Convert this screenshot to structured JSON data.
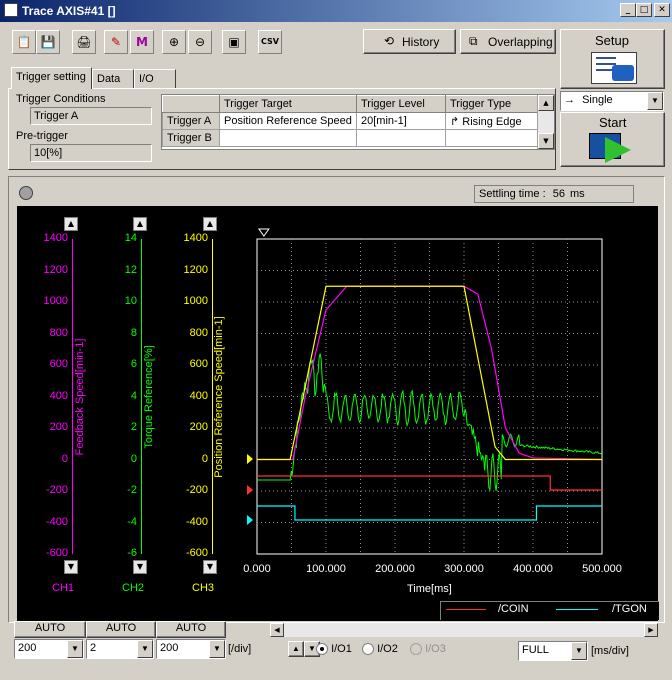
{
  "window": {
    "title": "Trace  AXIS#41 []"
  },
  "toolbar": {
    "icons": [
      "open-icon",
      "save-icon",
      "print-icon",
      "zoom-pen-icon",
      "cursor-m-icon",
      "zoom-in-icon",
      "zoom-out-icon",
      "capture-icon",
      "csv-icon"
    ],
    "csv_label": "CSV",
    "history_label": "History",
    "overlapping_label": "Overlapping"
  },
  "setup": {
    "label": "Setup"
  },
  "run_mode": {
    "selected": "Single"
  },
  "start": {
    "label": "Start"
  },
  "tabs": [
    {
      "label": "Trigger setting",
      "active": true
    },
    {
      "label": "Data",
      "active": false
    },
    {
      "label": "I/O",
      "active": false
    }
  ],
  "trigger": {
    "conditions_label": "Trigger Conditions",
    "conditions_value": "Trigger A",
    "pretrigger_label": "Pre-trigger",
    "pretrigger_value": "10[%]",
    "headers": [
      "Trigger Target",
      "Trigger Level",
      "Trigger Type"
    ],
    "rows": [
      {
        "name": "Trigger A",
        "target": "Position Reference Speed",
        "level": "20[min-1]",
        "type": "Rising Edge"
      },
      {
        "name": "Trigger B",
        "target": "",
        "level": "",
        "type": ""
      }
    ]
  },
  "settling": {
    "label": "Settling time :",
    "value": "56",
    "unit": "ms"
  },
  "axes": {
    "ch1": {
      "label": "Feedback Speed[min-1]",
      "ticks": [
        "1400",
        "1200",
        "1000",
        "800",
        "600",
        "400",
        "200",
        "0",
        "-200",
        "-400",
        "-600"
      ],
      "color": "#ff00ff",
      "name": "CH1"
    },
    "ch2": {
      "label": "Torque Reference[%]",
      "ticks": [
        "14",
        "12",
        "10",
        "8",
        "6",
        "4",
        "2",
        "0",
        "-2",
        "-4",
        "-6"
      ],
      "color": "#00ff00",
      "name": "CH2"
    },
    "ch3": {
      "label": "Position Reference Speed[min-1]",
      "ticks": [
        "1400",
        "1200",
        "1000",
        "800",
        "600",
        "400",
        "200",
        "0",
        "-200",
        "-400",
        "-600"
      ],
      "color": "#ffff00",
      "name": "CH3"
    }
  },
  "xaxis": {
    "label": "Time[ms]",
    "ticks": [
      "0.000",
      "100.000",
      "200.000",
      "300.000",
      "400.000",
      "500.000"
    ]
  },
  "chart_data": {
    "type": "line",
    "xlabel": "Time[ms]",
    "xlim": [
      0,
      500
    ],
    "ylim": [
      -600,
      1400
    ],
    "series": [
      {
        "name": "Position Reference Speed",
        "color": "#ffff00",
        "x": [
          0,
          48,
          100,
          300,
          345,
          360,
          500
        ],
        "y": [
          0,
          0,
          1100,
          1100,
          80,
          0,
          0
        ]
      },
      {
        "name": "Feedback Speed",
        "color": "#ff00ff",
        "x": [
          0,
          52,
          70,
          100,
          130,
          300,
          320,
          340,
          360,
          380,
          400,
          500
        ],
        "y": [
          0,
          0,
          400,
          950,
          1100,
          1100,
          1050,
          700,
          200,
          40,
          10,
          0
        ]
      }
    ],
    "digital": [
      {
        "name": "/COIN",
        "color": "#ff3030"
      },
      {
        "name": "/TGON",
        "color": "#00ffff"
      }
    ]
  },
  "legend": {
    "coin": "/COIN",
    "tgon": "/TGON"
  },
  "bottom": {
    "auto_labels": [
      "AUTO",
      "AUTO",
      "AUTO"
    ],
    "div_values": [
      "200",
      "2",
      "200"
    ],
    "div_unit": "[/div]",
    "io_options": [
      "I/O1",
      "I/O2",
      "I/O3"
    ],
    "io_selected": "I/O1",
    "time_select": "FULL",
    "time_unit": "[ms/div]"
  }
}
